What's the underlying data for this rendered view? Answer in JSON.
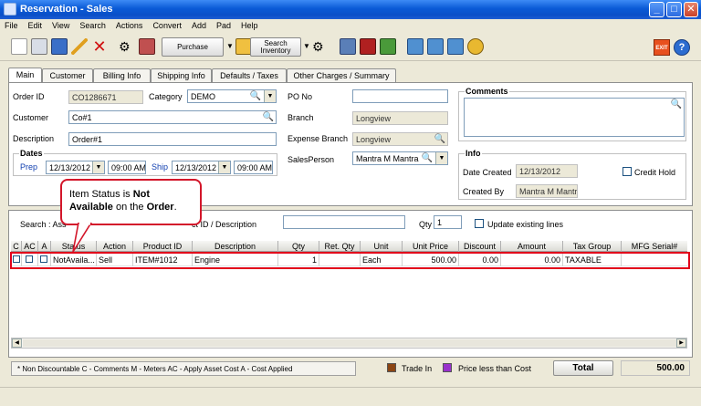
{
  "window": {
    "title": "Reservation - Sales"
  },
  "menu": [
    "File",
    "Edit",
    "View",
    "Search",
    "Actions",
    "Convert",
    "Add",
    "Pad",
    "Help"
  ],
  "toolbar": {
    "purchase_label": "Purchase",
    "search_label_1": "Search",
    "search_label_2": "Inventory",
    "exit_label": "EXIT",
    "help_label": "?"
  },
  "tabs": [
    "Main",
    "Customer",
    "Billing Info",
    "Shipping Info",
    "Defaults / Taxes",
    "Other Charges / Summary"
  ],
  "form": {
    "order_id_label": "Order ID",
    "order_id": "CO1286671",
    "category_label": "Category",
    "category": "DEMO",
    "po_label": "PO No",
    "po_value": "",
    "comments_label": "Comments",
    "customer_label": "Customer",
    "customer": "Co#1",
    "branch_label": "Branch",
    "branch": "Longview",
    "description_label": "Description",
    "description": "Order#1",
    "expense_branch_label": "Expense Branch",
    "expense_branch": "Longview",
    "dates_label": "Dates",
    "prep_label": "Prep",
    "prep_date": "12/13/2012",
    "prep_time": "09:00 AM",
    "ship_label": "Ship",
    "ship_date": "12/13/2012",
    "ship_time": "09:00 AM",
    "salesperson_label": "SalesPerson",
    "salesperson": "Mantra M Mantra",
    "info_label": "Info",
    "date_created_label": "Date Created",
    "date_created": "12/13/2012",
    "created_by_label": "Created By",
    "created_by": "Mantra M Mantra",
    "credit_hold_label": "Credit Hold"
  },
  "search": {
    "label": "Search : Ass",
    "label2": "ct ID / Description",
    "qty_label": "Qty",
    "qty_value": "1",
    "update_label": "Update existing lines"
  },
  "grid": {
    "headers": [
      "C",
      "AC",
      "A",
      "Status",
      "Action",
      "Product ID",
      "Description",
      "Qty",
      "Ret. Qty",
      "Unit",
      "Unit Price",
      "Discount",
      "Amount",
      "Tax Group",
      "MFG Serial#"
    ],
    "row": [
      "",
      "",
      "",
      "NotAvaila...",
      "Sell",
      "ITEM#1012",
      "Engine",
      "1",
      "",
      "Each",
      "500.00",
      "0.00",
      "0.00",
      "TAXABLE",
      ""
    ]
  },
  "callout": {
    "line1": "Item Status is ",
    "bold1": "Not",
    "bold2": "Available",
    "line2": " on the ",
    "bold3": "Order",
    "line3": "."
  },
  "footer": {
    "legend": "* Non Discountable  C - Comments  M - Meters  AC - Apply Asset Cost  A - Cost Applied",
    "trade_in": "Trade In",
    "price_less": "Price less than Cost",
    "total_label": "Total",
    "total_value": "500.00",
    "trade_in_color": "#8b4513",
    "price_less_color": "#9932cc"
  }
}
